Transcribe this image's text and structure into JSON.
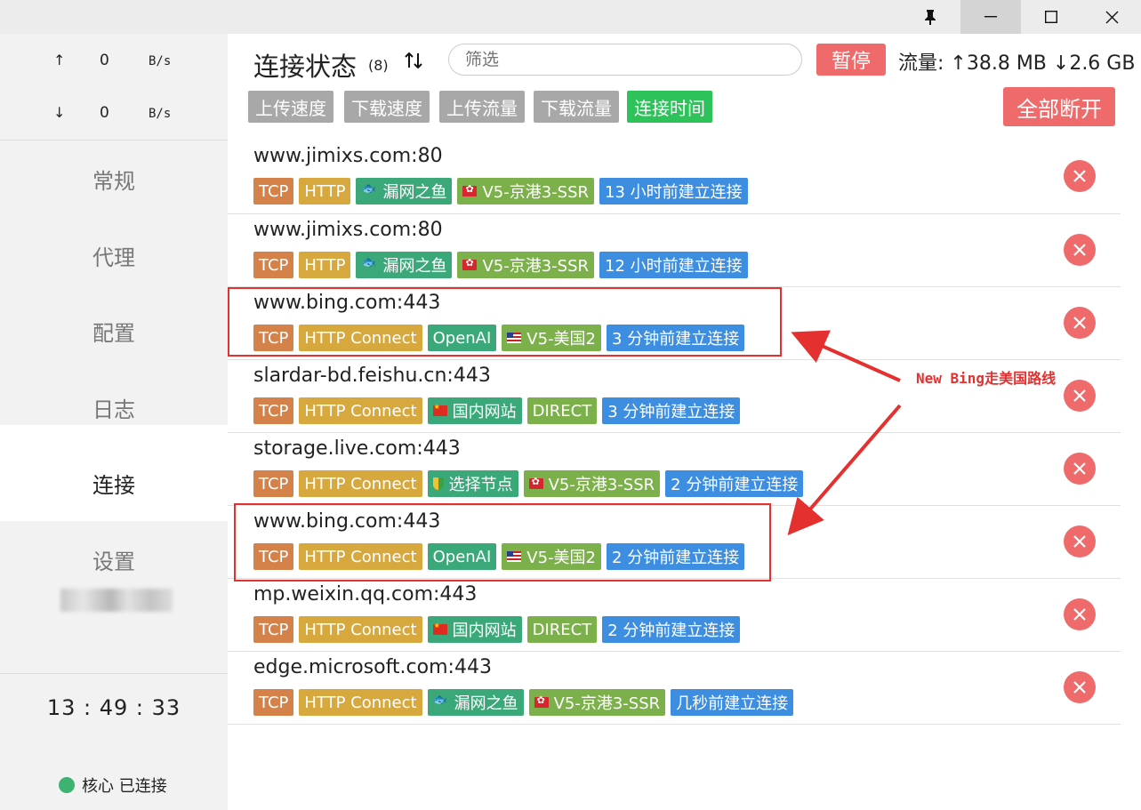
{
  "window": {
    "pin_icon": "pin-icon",
    "minimize_icon": "minimize-icon",
    "maximize_icon": "maximize-icon",
    "close_icon": "close-icon"
  },
  "sidebar": {
    "upload": {
      "arrow": "↑",
      "value": "0",
      "unit": "B/s"
    },
    "download": {
      "arrow": "↓",
      "value": "0",
      "unit": "B/s"
    },
    "nav": [
      {
        "label": "常规"
      },
      {
        "label": "代理"
      },
      {
        "label": "配置"
      },
      {
        "label": "日志"
      },
      {
        "label": "连接"
      },
      {
        "label": "设置"
      }
    ],
    "active_nav": "连接",
    "clock": "13 : 49 : 33",
    "core_status": "核心 已连接",
    "core_status_color": "#3cb371"
  },
  "header": {
    "title": "连接状态",
    "count": "(8)",
    "filter_placeholder": "筛选",
    "pause_label": "暂停",
    "traffic": "流量: ↑38.8 MB ↓2.6 GB",
    "sort_buttons": [
      {
        "label": "上传速度",
        "active": false
      },
      {
        "label": "下载速度",
        "active": false
      },
      {
        "label": "上传流量",
        "active": false
      },
      {
        "label": "下载流量",
        "active": false
      },
      {
        "label": "连接时间",
        "active": true
      }
    ],
    "disconnect_all_label": "全部断开"
  },
  "connections": [
    {
      "host": "www.jimixs.com:80",
      "network": "TCP",
      "type": "HTTP",
      "rule": "漏网之鱼",
      "rule_icon": "fish",
      "node": "V5-京港3-SSR",
      "node_flag": "hk",
      "time": "13 小时前建立连接"
    },
    {
      "host": "www.jimixs.com:80",
      "network": "TCP",
      "type": "HTTP",
      "rule": "漏网之鱼",
      "rule_icon": "fish",
      "node": "V5-京港3-SSR",
      "node_flag": "hk",
      "time": "12 小时前建立连接"
    },
    {
      "host": "www.bing.com:443",
      "network": "TCP",
      "type": "HTTP Connect",
      "rule": "OpenAI",
      "rule_icon": "",
      "node": "V5-美国2",
      "node_flag": "us",
      "time": "3 分钟前建立连接"
    },
    {
      "host": "slardar-bd.feishu.cn:443",
      "network": "TCP",
      "type": "HTTP Connect",
      "rule": "国内网站",
      "rule_icon": "cn",
      "node": "DIRECT",
      "node_flag": "",
      "time": "3 分钟前建立连接"
    },
    {
      "host": "storage.live.com:443",
      "network": "TCP",
      "type": "HTTP Connect",
      "rule": "选择节点",
      "rule_icon": "leaf",
      "node": "V5-京港3-SSR",
      "node_flag": "hk",
      "time": "2 分钟前建立连接"
    },
    {
      "host": "www.bing.com:443",
      "network": "TCP",
      "type": "HTTP Connect",
      "rule": "OpenAI",
      "rule_icon": "",
      "node": "V5-美国2",
      "node_flag": "us",
      "time": "2 分钟前建立连接"
    },
    {
      "host": "mp.weixin.qq.com:443",
      "network": "TCP",
      "type": "HTTP Connect",
      "rule": "国内网站",
      "rule_icon": "cn",
      "node": "DIRECT",
      "node_flag": "",
      "time": "2 分钟前建立连接"
    },
    {
      "host": "edge.microsoft.com:443",
      "network": "TCP",
      "type": "HTTP Connect",
      "rule": "漏网之鱼",
      "rule_icon": "fish",
      "node": "V5-京港3-SSR",
      "node_flag": "hk",
      "time": "几秒前建立连接"
    }
  ],
  "annotation": {
    "text": "New Bing走美国路线",
    "color": "#e53030"
  }
}
